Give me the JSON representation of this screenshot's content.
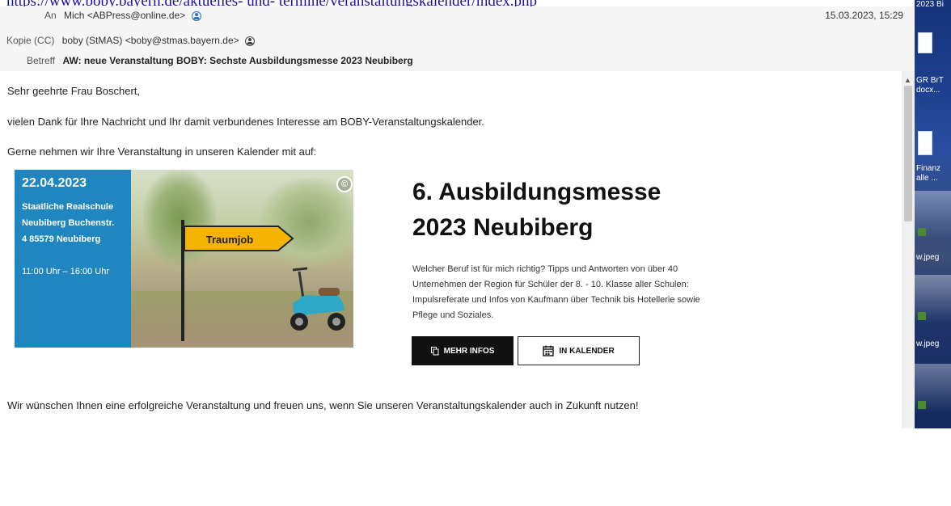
{
  "top_link": "https://www.boby.bayern.de/aktuelles- und- termine/veranstaltungskalender/index.php",
  "header": {
    "to_label": "An",
    "to_value": "Mich <ABPress@online.de>",
    "cc_label": "Kopie (CC)",
    "cc_value": "boby (StMAS) <boby@stmas.bayern.de>",
    "subject_label": "Betreff",
    "subject_value": "AW: neue Veranstaltung BOBY: Sechste Ausbildungsmesse 2023 Neubiberg",
    "date": "15.03.2023, 15:29"
  },
  "body": {
    "greeting": "Sehr geehrte Frau Boschert,",
    "para1": "vielen Dank für Ihre Nachricht und Ihr damit verbundenes Interesse am BOBY-Veranstaltungskalender.",
    "para2": "Gerne nehmen wir Ihre Veranstaltung in unseren Kalender mit auf:",
    "closing": "Wir wünschen Ihnen eine erfolgreiche Veranstaltung und freuen uns, wenn Sie unseren Veranstaltungskalender auch in Zukunft nutzen!"
  },
  "event": {
    "date": "22.04.2023",
    "venue_lines": [
      "Staatliche Realschule",
      "Neubiberg Buchenstr.",
      "4 85579 Neubiberg"
    ],
    "time": "11:00 Uhr – 16:00 Uhr",
    "sign_text": "Traumjob",
    "copyright_symbol": "©",
    "title_line1": "6. Ausbildungsmesse",
    "title_line2": "2023 Neubiberg",
    "description": "Welcher Beruf ist für mich richtig? Tipps und Antworten von über 40 Unternehmen der Region für Schüler der 8. - 10. Klasse aller Schulen: Impulsreferate und Infos von Kaufmann über Technik bis Hotellerie sowie Pflege und Soziales.",
    "btn_more": "MEHR INFOS",
    "btn_calendar": "IN KALENDER"
  },
  "desktop_labels": {
    "top": "2023 Bi",
    "item1_line1": "GR BrT",
    "item1_line2": "docx...",
    "item2_line1": "Finanz",
    "item2_line2": "alle ...",
    "item3": "w.jpeg",
    "item4": "w.jpeg"
  },
  "colors": {
    "banner_blue": "#1f86c0",
    "sign_yellow": "#f5b400",
    "link_blue": "#1a0dab"
  }
}
